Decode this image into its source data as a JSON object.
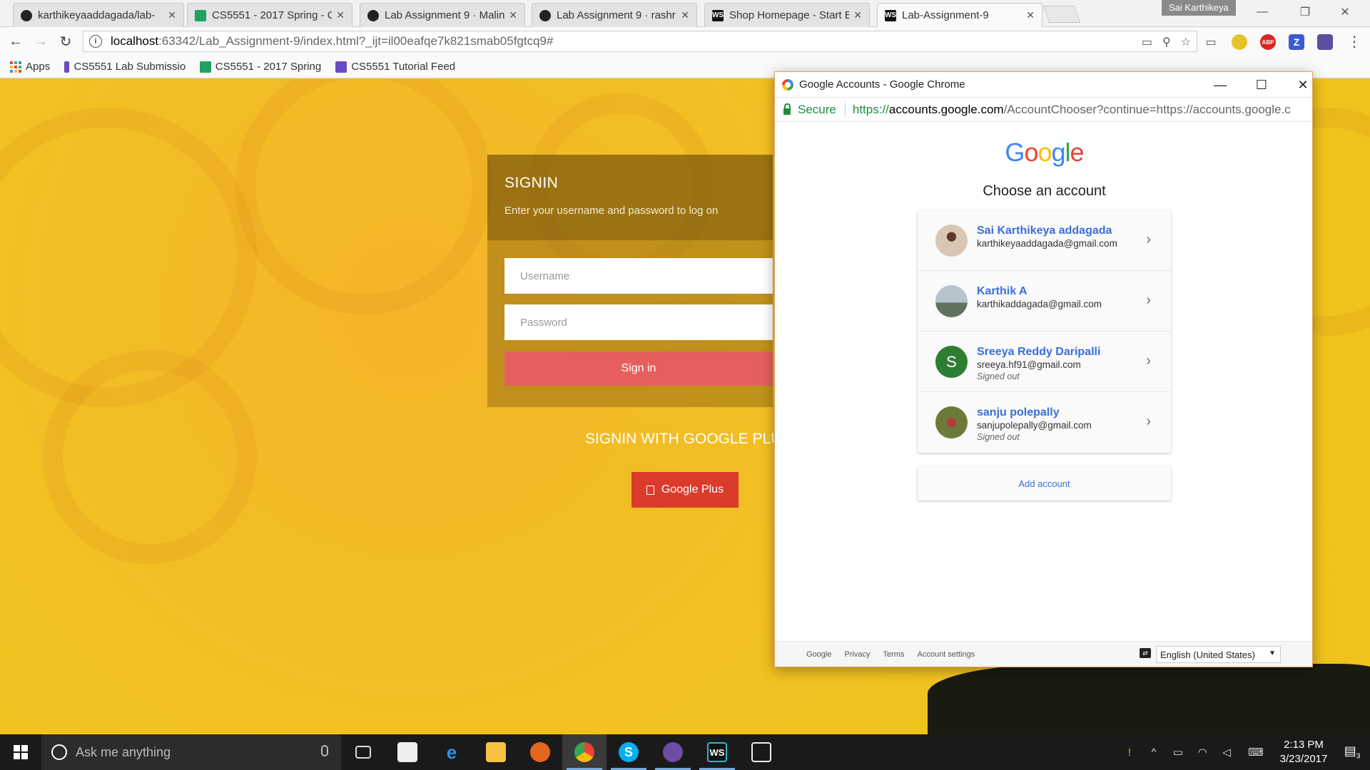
{
  "browser": {
    "tabs": [
      {
        "title": "karthikeyaaddagada/lab-",
        "favicon": "github-icon",
        "active": false
      },
      {
        "title": "CS5551 - 2017 Spring - C",
        "favicon": "sheets-icon",
        "active": false
      },
      {
        "title": "Lab Assignment 9 · Malin",
        "favicon": "github-icon",
        "active": false
      },
      {
        "title": "Lab Assignment 9 · rashr",
        "favicon": "github-icon",
        "active": false
      },
      {
        "title": "Shop Homepage - Start B",
        "favicon": "webstorm-icon",
        "active": false
      },
      {
        "title": "Lab-Assignment-9",
        "favicon": "webstorm-icon",
        "active": true
      }
    ],
    "profile_name": "Sai Karthikeya",
    "url_host": "localhost",
    "url_rest": ":63342/Lab_Assignment-9/index.html?_ijt=il00eafqe7k821smab05fgtcq9#",
    "bookmarks": [
      {
        "label": "Apps"
      },
      {
        "label": "CS5551 Lab Submissio"
      },
      {
        "label": "CS5551 - 2017 Spring"
      },
      {
        "label": "CS5551 Tutorial Feed"
      }
    ]
  },
  "page": {
    "signin_title": "SIGNIN",
    "signin_subtitle": "Enter your username and password to log on",
    "username_placeholder": "Username",
    "password_placeholder": "Password",
    "signin_button": "Sign in",
    "google_plus_heading": "SIGNIN WITH GOOGLE PLU",
    "google_plus_button": "Google Plus"
  },
  "popup": {
    "window_title": "Google Accounts - Google Chrome",
    "secure_label": "Secure",
    "url_scheme": "https://",
    "url_host": "accounts.google.com",
    "url_rest": "/AccountChooser?continue=https://accounts.google.c",
    "logo_text": "Google",
    "heading": "Choose an account",
    "accounts": [
      {
        "name": "Sai Karthikeya addagada",
        "email": "karthikeyaaddagada@gmail.com",
        "status": "",
        "initial": ""
      },
      {
        "name": "Karthik A",
        "email": "karthikaddagada@gmail.com",
        "status": "",
        "initial": ""
      },
      {
        "name": "Sreeya Reddy Daripalli",
        "email": "sreeya.hf91@gmail.com",
        "status": "Signed out",
        "initial": "S"
      },
      {
        "name": "sanju polepally",
        "email": "sanjupolepally@gmail.com",
        "status": "Signed out",
        "initial": ""
      }
    ],
    "add_account": "Add account",
    "footer_links": [
      "Google",
      "Privacy",
      "Terms",
      "Account settings"
    ],
    "language": "English (United States)"
  },
  "taskbar": {
    "search_placeholder": "Ask me anything",
    "time": "2:13 PM",
    "date": "3/23/2017",
    "notification_count": "3"
  }
}
